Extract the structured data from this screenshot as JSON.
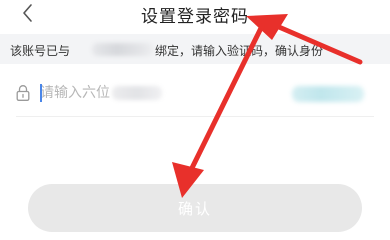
{
  "header": {
    "back_icon": "chevron-left-icon",
    "title": "设置登录密码"
  },
  "notice": {
    "prefix": "该账号已与",
    "suffix": "绑定，请输入验证码，确认身份"
  },
  "code_field": {
    "lock_icon": "lock-icon",
    "placeholder": "请输入六位"
  },
  "confirm": {
    "label": "确认"
  },
  "colors": {
    "annotation_arrow": "#e8302b",
    "button_disabled": "#e8e8e8",
    "notice_background": "#f3f4f6"
  }
}
